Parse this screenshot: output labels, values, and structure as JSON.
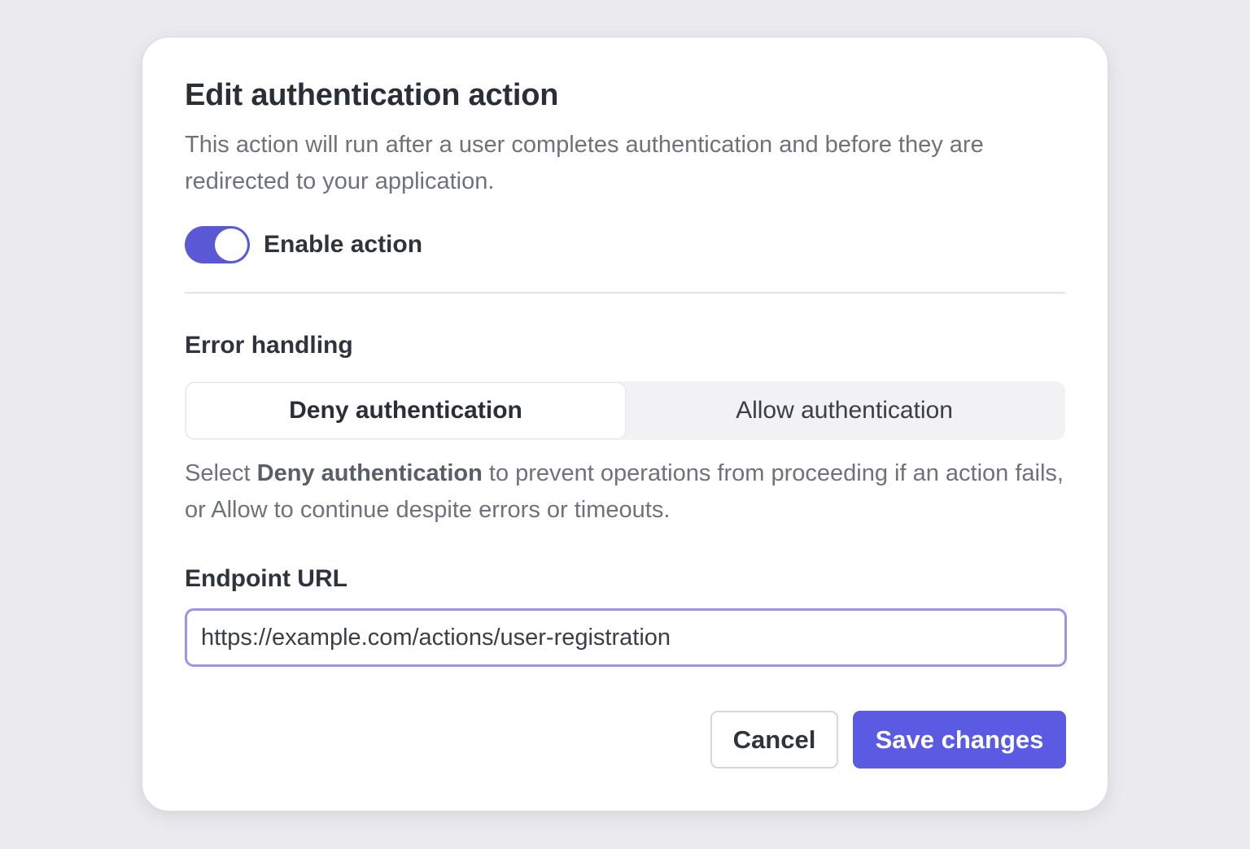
{
  "dialog": {
    "title": "Edit authentication action",
    "description": "This action will run after a user completes authentication and before they are redirected to your application."
  },
  "toggle": {
    "label": "Enable action",
    "enabled": true,
    "color": "#5b58d6"
  },
  "error_handling": {
    "label": "Error handling",
    "options": [
      "Deny authentication",
      "Allow authentication"
    ],
    "selected": "Deny authentication",
    "help_prefix": "Select ",
    "help_bold": "Deny authentication",
    "help_suffix": " to prevent operations from proceeding if an action fails, or Allow to continue despite errors or timeouts."
  },
  "endpoint": {
    "label": "Endpoint URL",
    "value": "https://example.com/actions/user-registration"
  },
  "buttons": {
    "cancel": "Cancel",
    "save": "Save changes",
    "save_color": "#5b5ae3"
  }
}
